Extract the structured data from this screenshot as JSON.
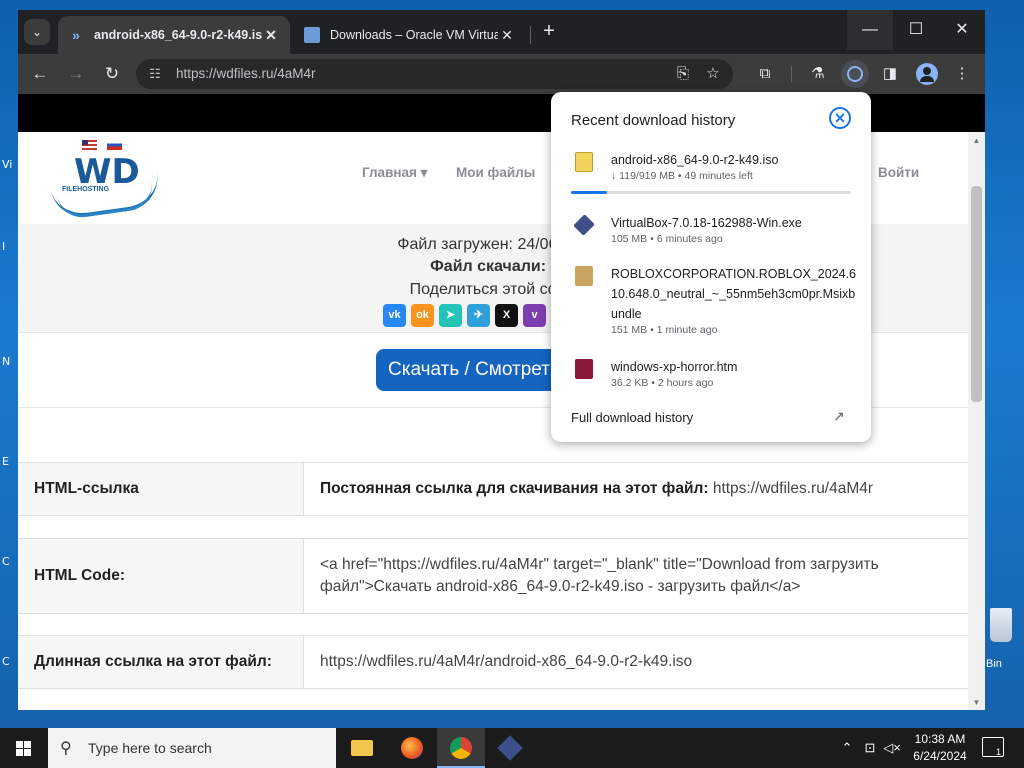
{
  "browser": {
    "tabs": [
      {
        "title": "android-x86_64-9.0-r2-k49.iso",
        "active": true
      },
      {
        "title": "Downloads – Oracle VM Virtua",
        "active": false
      }
    ],
    "address": "https://wdfiles.ru/4aM4r"
  },
  "site": {
    "logo_text": "WD",
    "logo_sub": "FILEHOSTING",
    "menu": {
      "home": "Главная ▾",
      "my_files": "Мои файлы",
      "login": "Войти"
    },
    "uploaded": "Файл загружен: 24/06/202",
    "downloaded": "Файл скачали: (",
    "share": "Поделиться этой ссыл",
    "download_button": "Скачать / Смотрет",
    "rows": [
      {
        "label": "HTML-ссылка",
        "bold_prefix": "Постоянная ссылка для скачивания на этот файл:",
        "value": " https://wdfiles.ru/4aM4r"
      },
      {
        "label": "HTML Code:",
        "bold_prefix": "",
        "value": "<a href=\"https://wdfiles.ru/4aM4r\" target=\"_blank\" title=\"Download from загрузить файл\">Скачать android-x86_64-9.0-r2-k49.iso - загрузить файл</a>"
      },
      {
        "label": "Длинная ссылка на этот файл:",
        "bold_prefix": "",
        "value": "https://wdfiles.ru/4aM4r/android-x86_64-9.0-r2-k49.iso"
      }
    ]
  },
  "downloads_panel": {
    "title": "Recent download history",
    "items": [
      {
        "name": "android-x86_64-9.0-r2-k49.iso",
        "meta": "↓ 119/919 MB • 49 minutes left",
        "progress": 0.13
      },
      {
        "name": "VirtualBox-7.0.18-162988-Win.exe",
        "meta": "105 MB • 6 minutes ago"
      },
      {
        "name": "ROBLOXCORPORATION.ROBLOX_2024.610.648.0_neutral_~_55nm5eh3cm0pr.Msixbundle",
        "meta": "151 MB • 1 minute ago"
      },
      {
        "name": "windows-xp-horror.htm",
        "meta": "36.2 KB • 2 hours ago"
      }
    ],
    "full_history": "Full download history"
  },
  "taskbar": {
    "search_placeholder": "Type here to search",
    "time": "10:38 AM",
    "date": "6/24/2024",
    "notification_count": "1"
  },
  "desktop": {
    "recycle_bin_label": "Bin"
  }
}
